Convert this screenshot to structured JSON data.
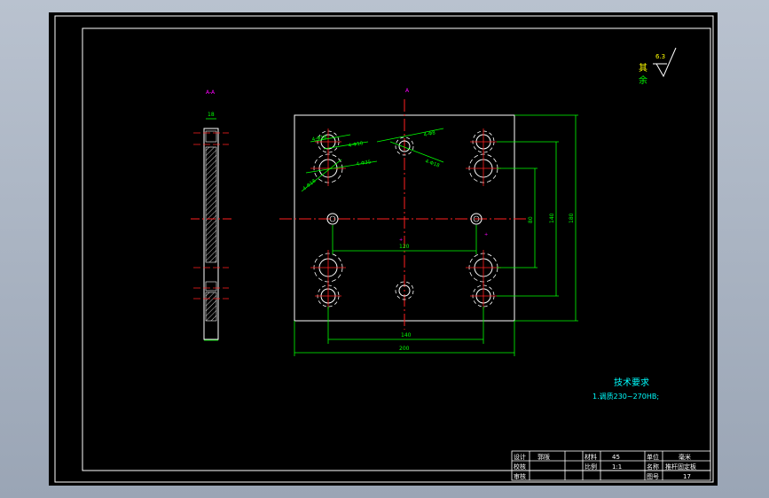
{
  "drawing": {
    "roughness_symbol": {
      "value": "6.3",
      "note_line1": "其",
      "note_line2": "余"
    },
    "dimensions": {
      "horizontal_inner": "120",
      "horizontal_mid": "140",
      "horizontal_overall": "200",
      "vertical_inner": "80",
      "vertical_mid": "140",
      "vertical_overall": "180",
      "thickness": "18"
    },
    "hole_callouts": [
      "4-Φ18",
      "4-Φ10",
      "4-Φ35",
      "4-Φ18",
      "4-Φ8",
      "4-Φ18"
    ],
    "section_marks": {
      "top": "A",
      "side": "A-A"
    }
  },
  "technical_requirements": {
    "title": "技术要求",
    "items": [
      "1.调质230~270HB;"
    ]
  },
  "title_block": {
    "designed_label": "设计",
    "designer_name": "郭阪",
    "checked_label": "校核",
    "approved_label": "审核",
    "material_label": "材料",
    "material_value": "45",
    "scale_label": "比例",
    "scale_value": "1:1",
    "unit_label": "单位",
    "unit_value": "毫米",
    "name_label": "名称",
    "name_value": "推杆固定板",
    "drawing_no_label": "图号",
    "drawing_no_value": "17"
  },
  "colors": {
    "background": "#000000",
    "border": "#ffffff",
    "center_line": "#ff2020",
    "dimension": "#00ff00",
    "text_cyan": "#00ffff",
    "hatch": "#ffffff",
    "magenta": "#ff00ff",
    "yellow": "#ffff00"
  }
}
